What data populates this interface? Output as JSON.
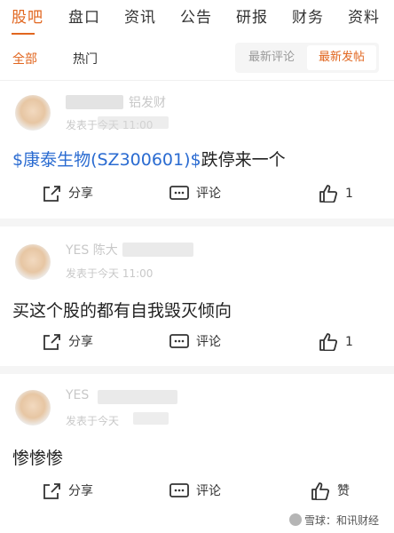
{
  "top_tabs": [
    "股吧",
    "盘口",
    "资讯",
    "公告",
    "研报",
    "财务",
    "资料"
  ],
  "sub_tabs": [
    "全部",
    "热门"
  ],
  "sort_options": {
    "latest_reply": "最新评论",
    "latest_post": "最新发帖"
  },
  "colors": {
    "accent": "#e1661f",
    "stock_link": "#2a6bd1"
  },
  "posts": [
    {
      "username_fragment": "铝发财",
      "time": "发表于今天 11:00",
      "stock_link": "$康泰生物(SZ300601)$",
      "text": "跌停来一个",
      "share": "分享",
      "comment": "评论",
      "like": "1"
    },
    {
      "username_fragment": "YES 陈大",
      "time": "发表于今天 11:00",
      "text": "买这个股的都有自我毁灭倾向",
      "share": "分享",
      "comment": "评论",
      "like": "1"
    },
    {
      "username_fragment": "YES",
      "time": "发表于今天",
      "text": "惨惨惨",
      "share": "分享",
      "comment": "评论",
      "like": "赞"
    }
  ],
  "watermark": "雪球：和讯财经"
}
